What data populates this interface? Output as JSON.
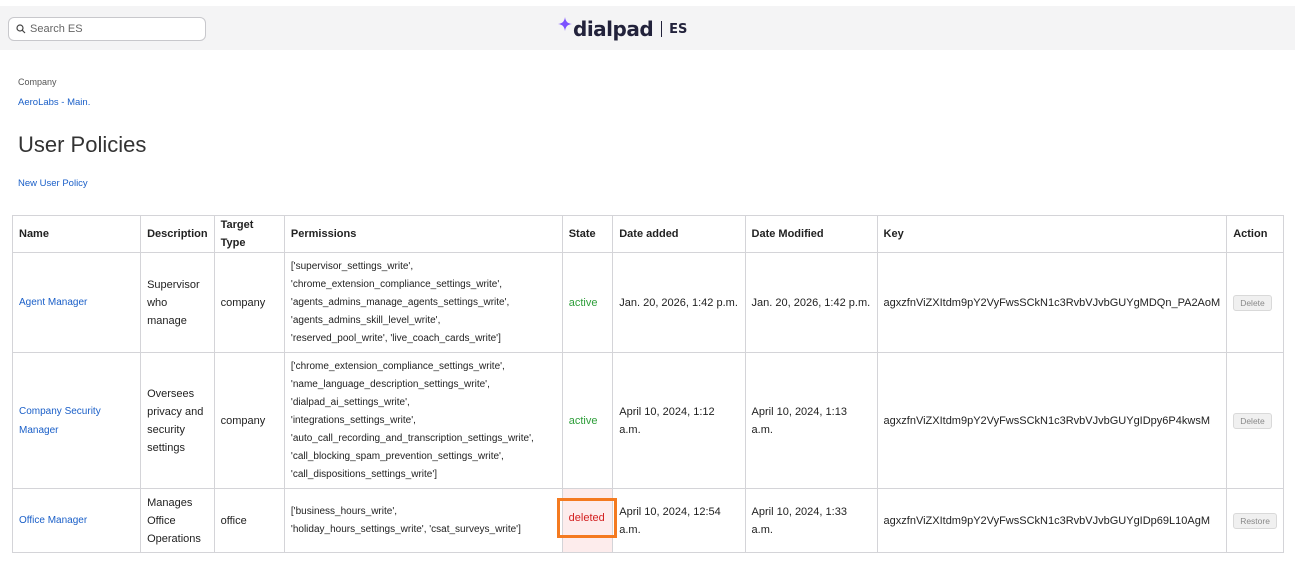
{
  "header": {
    "search_placeholder": "Search ES",
    "logo_text": "dialpad",
    "logo_suffix": "ES",
    "brand_color": "#7c52ff"
  },
  "breadcrumb": {
    "label": "Company",
    "link": "AeroLabs - Main."
  },
  "page": {
    "title": "User Policies",
    "new_link": "New User Policy"
  },
  "table": {
    "columns": [
      "Name",
      "Description",
      "Target Type",
      "Permissions",
      "State",
      "Date added",
      "Date Modified",
      "Key",
      "Action"
    ],
    "rows": [
      {
        "name": "Agent Manager",
        "description": [
          "Supervisor",
          "who",
          "manage"
        ],
        "target_type": "company",
        "permissions": [
          "['supervisor_settings_write',",
          "'chrome_extension_compliance_settings_write',",
          "'agents_admins_manage_agents_settings_write',",
          "'agents_admins_skill_level_write',",
          "'reserved_pool_write', 'live_coach_cards_write']"
        ],
        "state": "active",
        "date_added": "Jan. 20, 2026, 1:42 p.m.",
        "date_modified": "Jan. 20, 2026, 1:42 p.m.",
        "key": "agxzfnViZXItdm9pY2VyFwsSCkN1c3RvbVJvbGUYgMDQn_PA2AoM",
        "action": "Delete"
      },
      {
        "name": "Company Security Manager",
        "description": [
          "Oversees",
          "privacy and",
          "security",
          "settings"
        ],
        "target_type": "company",
        "permissions": [
          "['chrome_extension_compliance_settings_write',",
          "'name_language_description_settings_write',",
          "'dialpad_ai_settings_write',",
          "'integrations_settings_write',",
          "'auto_call_recording_and_transcription_settings_write',",
          "'call_blocking_spam_prevention_settings_write',",
          "'call_dispositions_settings_write']"
        ],
        "state": "active",
        "date_added": "April 10, 2024, 1:12 a.m.",
        "date_modified": "April 10, 2024, 1:13 a.m.",
        "key": "agxzfnViZXItdm9pY2VyFwsSCkN1c3RvbVJvbGUYgIDpy6P4kwsM",
        "action": "Delete"
      },
      {
        "name": "Office Manager",
        "description": [
          "Manages",
          "Office",
          "Operations"
        ],
        "target_type": "office",
        "permissions": [
          "['business_hours_write',",
          "'holiday_hours_settings_write', 'csat_surveys_write']"
        ],
        "state": "deleted",
        "date_added": "April 10, 2024, 12:54 a.m.",
        "date_modified": "April 10, 2024, 1:33 a.m.",
        "key": "agxzfnViZXItdm9pY2VyFwsSCkN1c3RvbVJvbGUYgIDp69L10AgM",
        "action": "Restore"
      }
    ]
  },
  "colors": {
    "link": "#1a5fc8",
    "active": "#2e9e3a",
    "deleted": "#d32020",
    "highlight": "#f47a20"
  }
}
